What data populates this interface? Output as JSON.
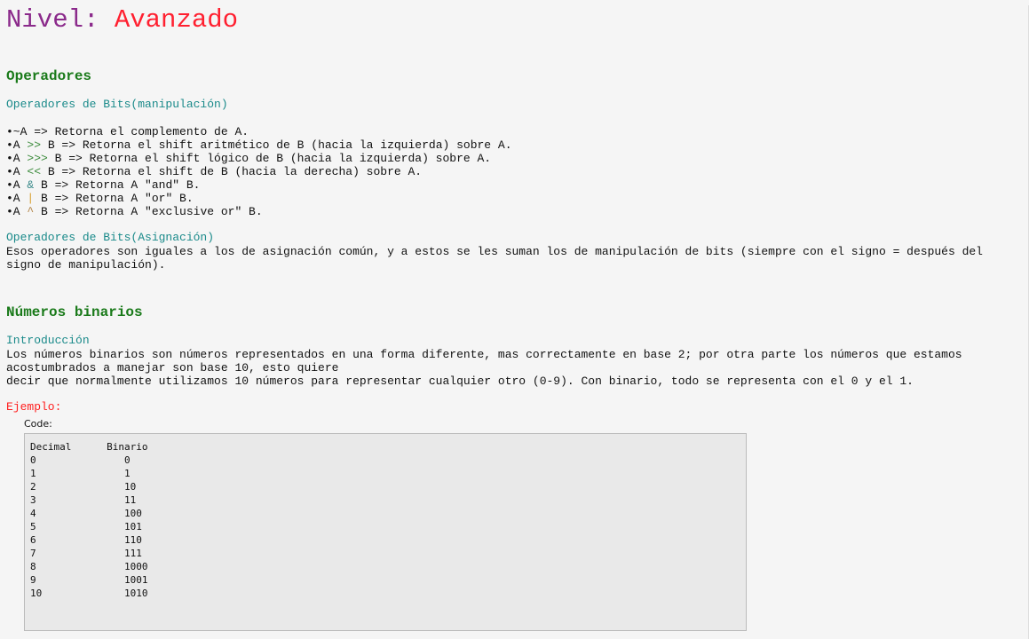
{
  "title": {
    "label": "Nivel:",
    "value": "Avanzado"
  },
  "sections": {
    "operadores": {
      "heading": "Operadores",
      "bits_manip": {
        "heading": "Operadores de Bits(manipulación)",
        "items": [
          {
            "pre": "•~A",
            "op": "",
            "post": " => Retorna el complemento de A."
          },
          {
            "pre": "•A ",
            "op": ">>",
            "post": " B => Retorna el shift aritmético de B (hacia la izquierda) sobre A."
          },
          {
            "pre": "•A ",
            "op": ">>>",
            "post": " B => Retorna el shift lógico de B (hacia la izquierda) sobre A."
          },
          {
            "pre": "•A ",
            "op": "<<",
            "post": " B => Retorna el shift de B (hacia la derecha) sobre A."
          },
          {
            "pre": "•A ",
            "op": "&",
            "post": " B => Retorna A \"and\" B."
          },
          {
            "pre": "•A ",
            "op": "|",
            "post": " B => Retorna A \"or\" B."
          },
          {
            "pre": "•A ",
            "op": "^",
            "post": " B => Retorna A \"exclusive or\" B."
          }
        ]
      },
      "bits_asig": {
        "heading": "Operadores de Bits(Asignación)",
        "text": "Esos operadores son iguales a los de asignación común, y a estos se les suman los de manipulación de bits (siempre con el signo = después del signo de manipulación)."
      }
    },
    "binarios": {
      "heading": "Números binarios",
      "intro_heading": "Introducción",
      "intro_line1": "Los números binarios son números representados en una forma diferente, mas correctamente en base 2; por otra parte los números que estamos acostumbrados a manejar son base 10, esto quiere",
      "intro_line2": "decir que normalmente utilizamos 10 números para representar cualquier otro (0-9). Con binario, todo se representa con el 0 y el 1.",
      "example_label": "Ejemplo:",
      "code_label": "Code:",
      "code": "Decimal      Binario\n0               0\n1               1\n2               10\n3               11\n4               100\n5               101\n6               110\n7               111\n8               1000\n9               1001\n10              1010"
    }
  }
}
